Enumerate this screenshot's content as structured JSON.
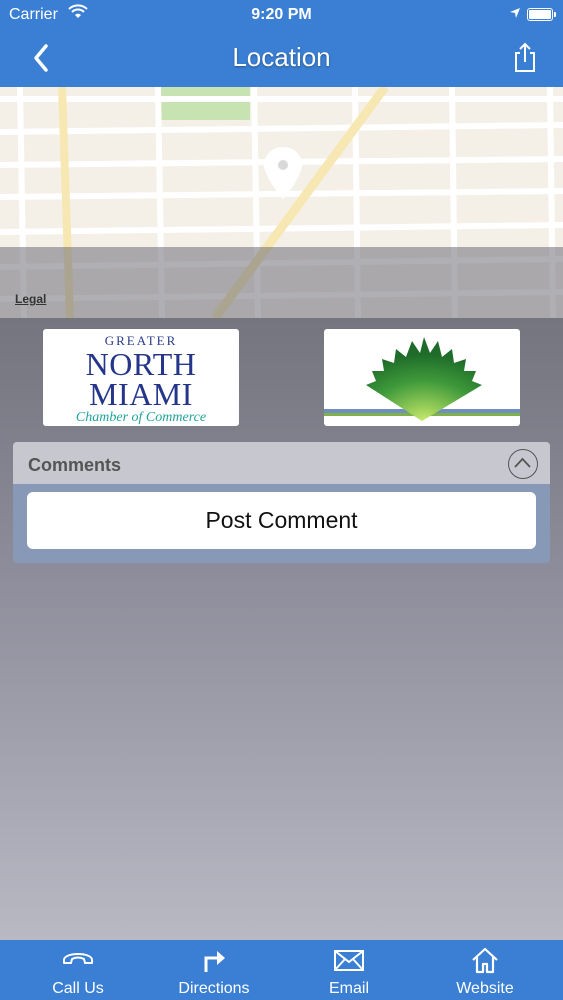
{
  "status_bar": {
    "carrier": "Carrier",
    "time": "9:20 PM"
  },
  "nav": {
    "title": "Location"
  },
  "map": {
    "legal_label": "Legal"
  },
  "logos": {
    "left": {
      "line1": "GREATER",
      "line2": "NORTH",
      "line3": "MIAMI",
      "line4": "Chamber of Commerce"
    }
  },
  "comments": {
    "header": "Comments",
    "post_button": "Post Comment"
  },
  "tabs": [
    {
      "label": "Call Us",
      "icon": "phone-icon"
    },
    {
      "label": "Directions",
      "icon": "directions-icon"
    },
    {
      "label": "Email",
      "icon": "email-icon"
    },
    {
      "label": "Website",
      "icon": "home-icon"
    }
  ],
  "colors": {
    "accent": "#3a7fd3",
    "comments_header": "#c7c7cf",
    "comments_body": "#8898b7"
  }
}
